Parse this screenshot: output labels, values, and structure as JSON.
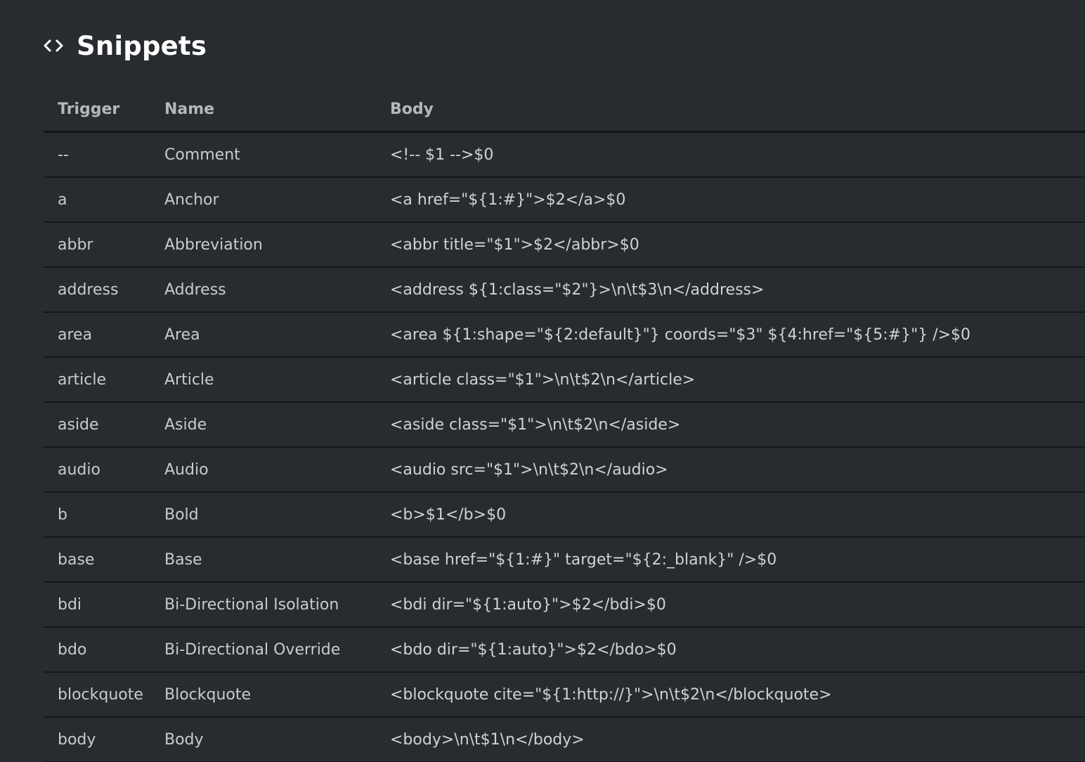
{
  "header": {
    "icon": "code-brackets-icon",
    "title": "Snippets"
  },
  "table": {
    "columns": [
      "Trigger",
      "Name",
      "Body"
    ],
    "rows": [
      {
        "trigger": "--",
        "name": "Comment",
        "body": "<!-- $1 -->$0"
      },
      {
        "trigger": "a",
        "name": "Anchor",
        "body": "<a href=\"${1:#}\">$2</a>$0"
      },
      {
        "trigger": "abbr",
        "name": "Abbreviation",
        "body": "<abbr title=\"$1\">$2</abbr>$0"
      },
      {
        "trigger": "address",
        "name": "Address",
        "body": "<address ${1:class=\"$2\"}>\\n\\t$3\\n</address>"
      },
      {
        "trigger": "area",
        "name": "Area",
        "body": "<area ${1:shape=\"${2:default}\"} coords=\"$3\" ${4:href=\"${5:#}\"} />$0"
      },
      {
        "trigger": "article",
        "name": "Article",
        "body": "<article class=\"$1\">\\n\\t$2\\n</article>"
      },
      {
        "trigger": "aside",
        "name": "Aside",
        "body": "<aside class=\"$1\">\\n\\t$2\\n</aside>"
      },
      {
        "trigger": "audio",
        "name": "Audio",
        "body": "<audio src=\"$1\">\\n\\t$2\\n</audio>"
      },
      {
        "trigger": "b",
        "name": "Bold",
        "body": "<b>$1</b>$0"
      },
      {
        "trigger": "base",
        "name": "Base",
        "body": "<base href=\"${1:#}\" target=\"${2:_blank}\" />$0"
      },
      {
        "trigger": "bdi",
        "name": "Bi-Directional Isolation",
        "body": "<bdi dir=\"${1:auto}\">$2</bdi>$0"
      },
      {
        "trigger": "bdo",
        "name": "Bi-Directional Override",
        "body": "<bdo dir=\"${1:auto}\">$2</bdo>$0"
      },
      {
        "trigger": "blockquote",
        "name": "Blockquote",
        "body": "<blockquote cite=\"${1:http://}\">\\n\\t$2\\n</blockquote>"
      },
      {
        "trigger": "body",
        "name": "Body",
        "body": "<body>\\n\\t$1\\n</body>"
      }
    ]
  }
}
